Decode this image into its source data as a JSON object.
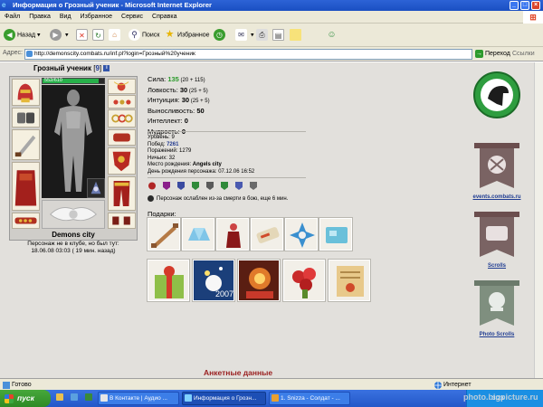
{
  "window": {
    "title": "Информация о Грозный ученик - Microsoft Internet Explorer"
  },
  "menu": [
    "Файл",
    "Правка",
    "Вид",
    "Избранное",
    "Сервис",
    "Справка"
  ],
  "toolbar": {
    "back": "Назад",
    "search": "Поиск",
    "favorites": "Избранное"
  },
  "address": {
    "label": "Адрес:",
    "url": "http://demonscity.combats.ru/inf.pl?login=Грозный%20ученик",
    "go": "Переход",
    "links": "Ссылки"
  },
  "character": {
    "name": "Грозный ученик",
    "level_open": "[",
    "level": "9",
    "level_close": "]",
    "info_mark": "i",
    "hp": "552/610",
    "hp_fraction": 0.905,
    "city": "Demons city",
    "presence": "Персонаж не в клубе, но был тут:",
    "last_seen": "18.06.08 03:03 ( 19 мин. назад)"
  },
  "stats": [
    {
      "label": "Сила: ",
      "value": "135",
      "bonus": " (20 + 115)",
      "green": true
    },
    {
      "label": "Ловкость: ",
      "value": "30",
      "bonus": " (25 + 5)",
      "green": false
    },
    {
      "label": "Интуиция: ",
      "value": "30",
      "bonus": " (25 + 5)",
      "green": false
    },
    {
      "label": "Выносливость: ",
      "value": "50",
      "bonus": "",
      "green": false
    },
    {
      "label": "Интеллект: ",
      "value": "0",
      "bonus": "",
      "green": false
    },
    {
      "label": "Мудрость: ",
      "value": "0",
      "bonus": "",
      "green": false
    }
  ],
  "details": [
    {
      "label": "Уровень: ",
      "value": "9",
      "bold": false
    },
    {
      "label": "Побед: ",
      "value": "7261",
      "bold": true
    },
    {
      "label": "Поражений: ",
      "value": "1279",
      "bold": false
    },
    {
      "label": "Ничьих: ",
      "value": "32",
      "bold": false
    },
    {
      "label": "Место рождения: ",
      "value": "Angels city",
      "bold": true
    },
    {
      "label": "День рождения персонажа: ",
      "value": "07.12.06 16:52",
      "bold": false
    }
  ],
  "weakness": "Персонаж ослаблен из-за смерти в бою, еще 6 мин.",
  "gifts_label": "Подарки:",
  "banners": [
    {
      "caption": ""
    },
    {
      "caption": "events.combats.ru"
    },
    {
      "caption": "Scrolls"
    },
    {
      "caption": "Photo Scrolls"
    }
  ],
  "footer_heading": "Анкетные данные",
  "status": {
    "left": "Готово",
    "right": "Интернет"
  },
  "taskbar": {
    "start": "пуск",
    "tasks": [
      "В Контакте | Аудио ...",
      "Информация о Грозн...",
      "1. Snizza - Солдат - ..."
    ],
    "clock": "3:23"
  },
  "watermark": "photo.bigpicture.ru",
  "colors": {
    "titlebar": "#1a4fc2",
    "green_stat": "#2a9a2a",
    "link_blue": "#1f3c92",
    "heading_red": "#9a2020"
  }
}
